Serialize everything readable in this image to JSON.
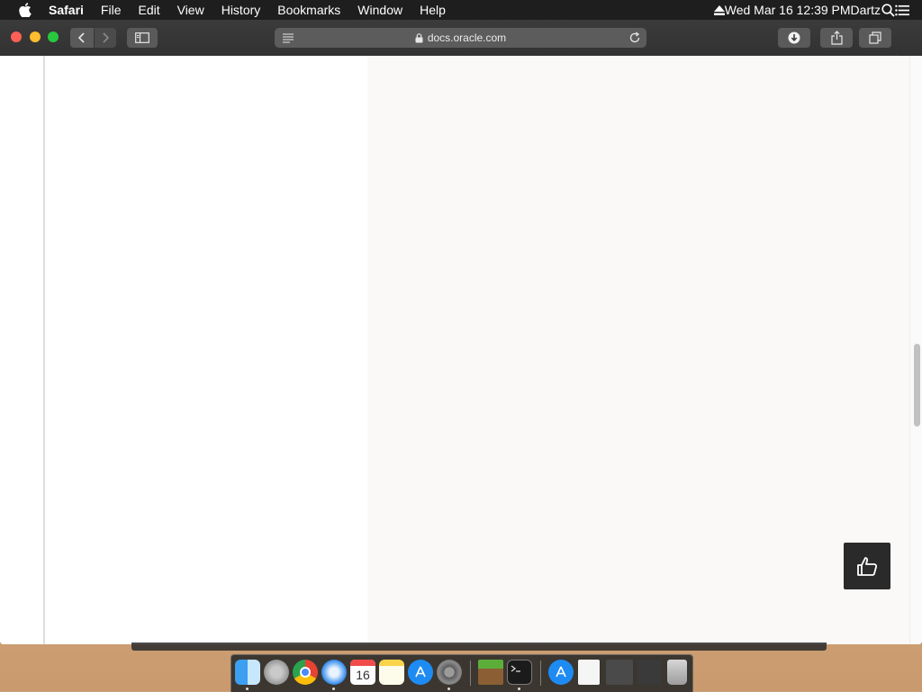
{
  "menubar": {
    "app_name": "Safari",
    "items": [
      "File",
      "Edit",
      "View",
      "History",
      "Bookmarks",
      "Window",
      "Help"
    ],
    "clock": "Wed Mar 16  12:39 PM",
    "user": "Dartz"
  },
  "browser": {
    "url": "docs.oracle.com"
  },
  "dock": {
    "calendar_day": "16"
  }
}
